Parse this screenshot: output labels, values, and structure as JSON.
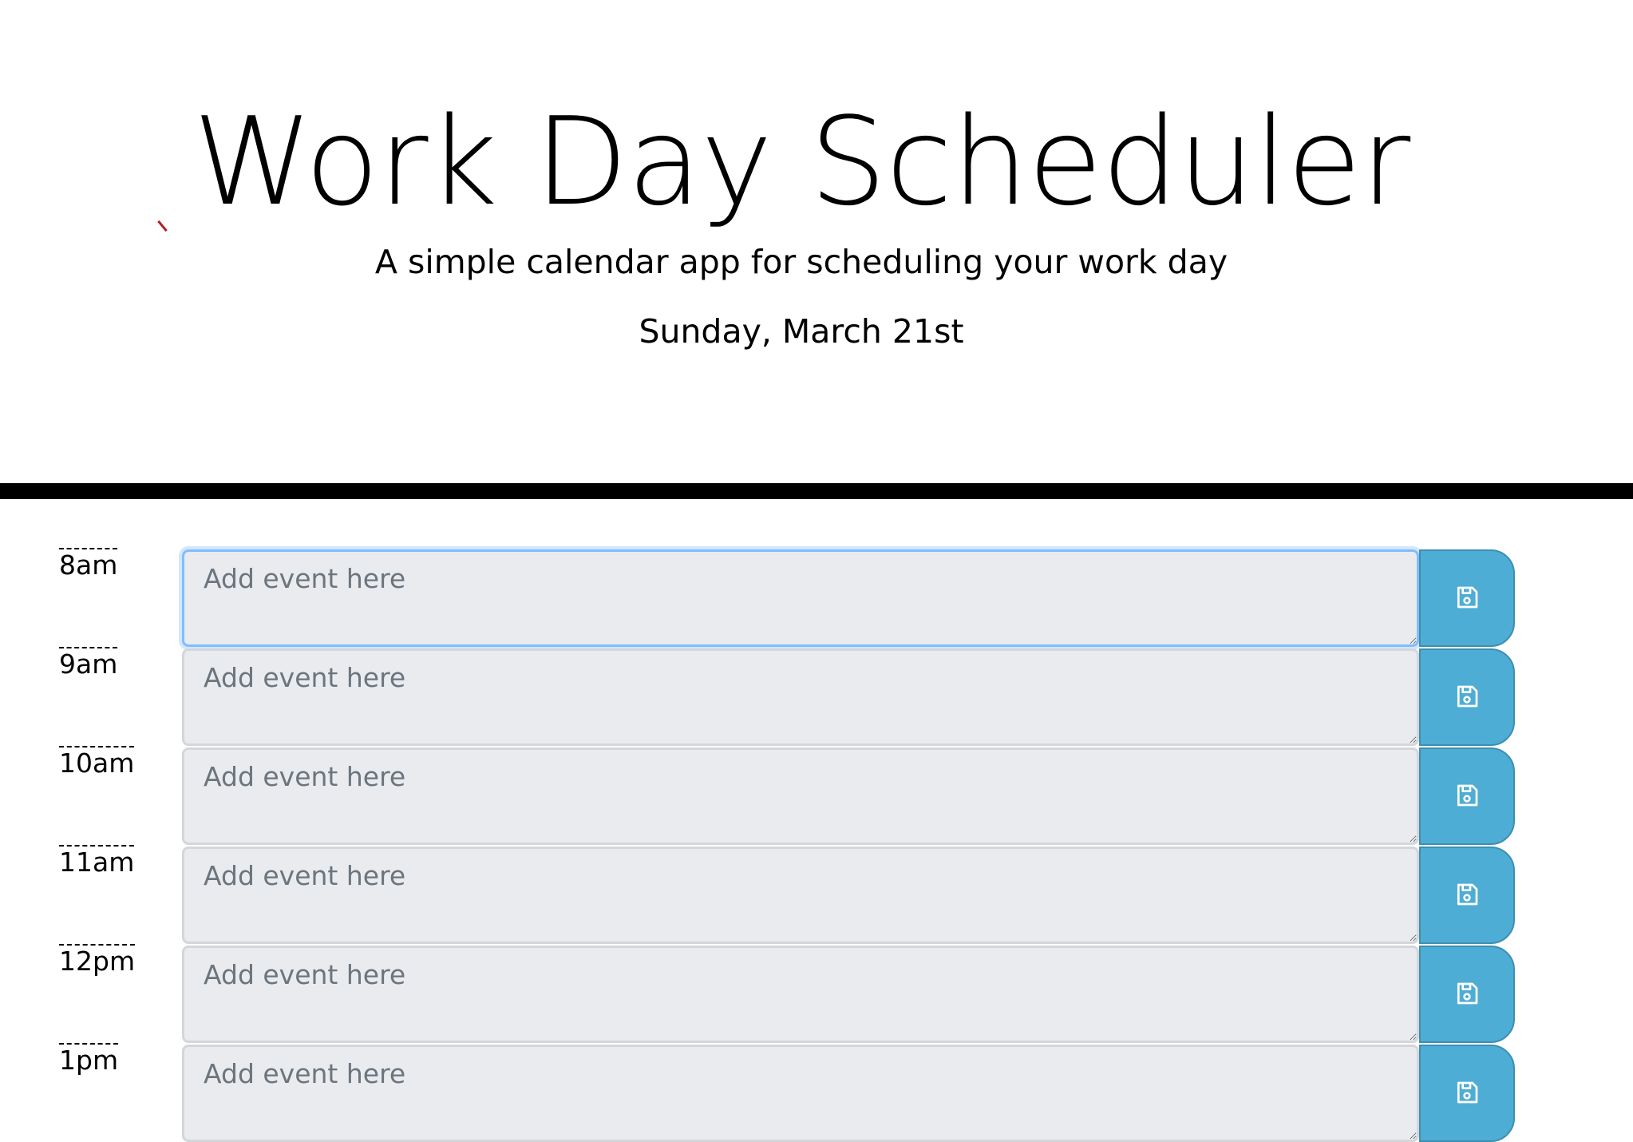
{
  "header": {
    "title": "Work Day Scheduler",
    "subtitle": "A simple calendar app for scheduling your work day",
    "current_day": "Sunday, March 21st"
  },
  "scheduler": {
    "placeholder": "Add event here",
    "save_icon": "floppy-disk-icon",
    "rows": [
      {
        "hour": "8am"
      },
      {
        "hour": "9am"
      },
      {
        "hour": "10am"
      },
      {
        "hour": "11am"
      },
      {
        "hour": "12pm"
      },
      {
        "hour": "1pm"
      }
    ]
  },
  "colors": {
    "save_button": "#4eadd4",
    "textarea_bg": "#e9ebef",
    "divider": "#000000"
  }
}
